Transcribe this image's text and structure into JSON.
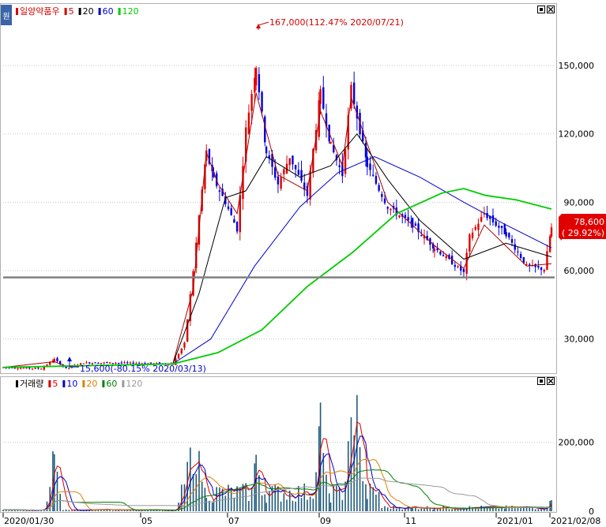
{
  "price_panel": {
    "legend": [
      {
        "text": "일양약품우",
        "color": "#d40000"
      },
      {
        "text": "5",
        "color": "#d40000"
      },
      {
        "text": "20",
        "color": "#000000"
      },
      {
        "text": "60",
        "color": "#0000cc"
      },
      {
        "text": "120",
        "color": "#00cc00"
      }
    ],
    "annotation_high": "167,000(112.47% 2020/07/21)",
    "annotation_low": "15,600(-80.15% 2020/03/13)",
    "last_price": "78,600",
    "last_change": "( 29.92%)",
    "side_tag": "원"
  },
  "volume_panel": {
    "legend": [
      {
        "text": "거래량",
        "color": "#000000"
      },
      {
        "text": "5",
        "color": "#d40000"
      },
      {
        "text": "10",
        "color": "#0000cc"
      },
      {
        "text": "20",
        "color": "#e08000"
      },
      {
        "text": "60",
        "color": "#008000"
      },
      {
        "text": "120",
        "color": "#999999"
      }
    ]
  },
  "x_axis_labels": [
    "2020/01/30",
    "05",
    "07",
    "09",
    "11",
    "2021/01",
    "2021/02/08"
  ],
  "colors": {
    "up": "#e00000",
    "down": "#0000dd",
    "ma5": "#aa0000",
    "ma20": "#000000",
    "ma60": "#0000cc",
    "ma120": "#00cc00",
    "hline": "#808080"
  },
  "chart_data": [
    {
      "type": "candlestick",
      "title": "일양약품우",
      "x_range": [
        "2020/01/30",
        "2021/02/08"
      ],
      "ylim": [
        16000,
        176000
      ],
      "y_ticks": [
        30000,
        60000,
        90000,
        120000,
        150000
      ],
      "y_tick_labels": [
        "30,000",
        "60,000",
        "90,000",
        "120,000",
        "150,000"
      ],
      "horizontal_line": 57000,
      "close_trend": [
        {
          "date": "2020-01-30",
          "close": 17500
        },
        {
          "date": "2020-02-25",
          "close": 17000
        },
        {
          "date": "2020-03-05",
          "close": 21000
        },
        {
          "date": "2020-03-13",
          "close": 17000
        },
        {
          "date": "2020-03-25",
          "close": 19500
        },
        {
          "date": "2020-04-20",
          "close": 19500
        },
        {
          "date": "2020-05-25",
          "close": 19000
        },
        {
          "date": "2020-06-02",
          "close": 28000
        },
        {
          "date": "2020-06-08",
          "close": 60000
        },
        {
          "date": "2020-06-12",
          "close": 84000
        },
        {
          "date": "2020-06-17",
          "close": 112000
        },
        {
          "date": "2020-06-22",
          "close": 100000
        },
        {
          "date": "2020-06-30",
          "close": 90000
        },
        {
          "date": "2020-07-08",
          "close": 78000
        },
        {
          "date": "2020-07-14",
          "close": 122000
        },
        {
          "date": "2020-07-21",
          "close": 150000
        },
        {
          "date": "2020-07-28",
          "close": 112000
        },
        {
          "date": "2020-08-05",
          "close": 98000
        },
        {
          "date": "2020-08-13",
          "close": 110000
        },
        {
          "date": "2020-08-25",
          "close": 93000
        },
        {
          "date": "2020-09-03",
          "close": 138000
        },
        {
          "date": "2020-09-10",
          "close": 115000
        },
        {
          "date": "2020-09-18",
          "close": 102000
        },
        {
          "date": "2020-09-24",
          "close": 140000
        },
        {
          "date": "2020-10-05",
          "close": 106000
        },
        {
          "date": "2020-10-19",
          "close": 88000
        },
        {
          "date": "2020-11-05",
          "close": 80000
        },
        {
          "date": "2020-11-20",
          "close": 70000
        },
        {
          "date": "2020-12-10",
          "close": 59000
        },
        {
          "date": "2020-12-14",
          "close": 75000
        },
        {
          "date": "2020-12-24",
          "close": 85000
        },
        {
          "date": "2021-01-08",
          "close": 76000
        },
        {
          "date": "2021-01-22",
          "close": 62000
        },
        {
          "date": "2021-02-03",
          "close": 60500
        },
        {
          "date": "2021-02-08",
          "close": 78600
        }
      ],
      "moving_averages": [
        {
          "name": "5",
          "points": [
            {
              "date": "2020-01-30",
              "value": 17500
            },
            {
              "date": "2020-03-05",
              "value": 20000
            },
            {
              "date": "2020-03-13",
              "value": 18000
            },
            {
              "date": "2020-05-25",
              "value": 19000
            },
            {
              "date": "2020-06-08",
              "value": 52000
            },
            {
              "date": "2020-06-17",
              "value": 112000
            },
            {
              "date": "2020-06-25",
              "value": 98000
            },
            {
              "date": "2020-07-08",
              "value": 85000
            },
            {
              "date": "2020-07-21",
              "value": 138000
            },
            {
              "date": "2020-08-05",
              "value": 102000
            },
            {
              "date": "2020-08-25",
              "value": 95000
            },
            {
              "date": "2020-09-03",
              "value": 130000
            },
            {
              "date": "2020-09-18",
              "value": 106000
            },
            {
              "date": "2020-09-24",
              "value": 136000
            },
            {
              "date": "2020-10-19",
              "value": 90000
            },
            {
              "date": "2020-11-20",
              "value": 71000
            },
            {
              "date": "2020-12-10",
              "value": 61000
            },
            {
              "date": "2020-12-24",
              "value": 80000
            },
            {
              "date": "2021-01-22",
              "value": 62000
            },
            {
              "date": "2021-02-08",
              "value": 63000
            }
          ]
        },
        {
          "name": "20",
          "points": [
            {
              "date": "2020-01-30",
              "value": 17500
            },
            {
              "date": "2020-05-25",
              "value": 19000
            },
            {
              "date": "2020-06-12",
              "value": 50000
            },
            {
              "date": "2020-06-30",
              "value": 92000
            },
            {
              "date": "2020-07-14",
              "value": 95000
            },
            {
              "date": "2020-07-28",
              "value": 110000
            },
            {
              "date": "2020-08-20",
              "value": 101000
            },
            {
              "date": "2020-09-10",
              "value": 106000
            },
            {
              "date": "2020-09-28",
              "value": 120000
            },
            {
              "date": "2020-10-19",
              "value": 100000
            },
            {
              "date": "2020-11-10",
              "value": 82000
            },
            {
              "date": "2020-12-10",
              "value": 65000
            },
            {
              "date": "2021-01-08",
              "value": 72000
            },
            {
              "date": "2021-02-08",
              "value": 66000
            }
          ]
        },
        {
          "name": "60",
          "points": [
            {
              "date": "2020-01-30",
              "value": 17500
            },
            {
              "date": "2020-05-25",
              "value": 19000
            },
            {
              "date": "2020-06-20",
              "value": 30000
            },
            {
              "date": "2020-07-20",
              "value": 62000
            },
            {
              "date": "2020-08-20",
              "value": 88000
            },
            {
              "date": "2020-09-15",
              "value": 103000
            },
            {
              "date": "2020-10-10",
              "value": 110000
            },
            {
              "date": "2020-11-10",
              "value": 101000
            },
            {
              "date": "2020-12-10",
              "value": 90000
            },
            {
              "date": "2021-01-08",
              "value": 80000
            },
            {
              "date": "2021-02-08",
              "value": 70000
            }
          ]
        },
        {
          "name": "120",
          "points": [
            {
              "date": "2020-01-30",
              "value": 17500
            },
            {
              "date": "2020-05-25",
              "value": 19000
            },
            {
              "date": "2020-06-25",
              "value": 24000
            },
            {
              "date": "2020-07-25",
              "value": 34000
            },
            {
              "date": "2020-08-25",
              "value": 53000
            },
            {
              "date": "2020-09-25",
              "value": 68000
            },
            {
              "date": "2020-10-25",
              "value": 85000
            },
            {
              "date": "2020-11-25",
              "value": 94000
            },
            {
              "date": "2020-12-10",
              "value": 96000
            },
            {
              "date": "2020-12-25",
              "value": 93000
            },
            {
              "date": "2021-01-15",
              "value": 91000
            },
            {
              "date": "2021-02-08",
              "value": 87000
            }
          ]
        }
      ]
    },
    {
      "type": "bar",
      "title": "거래량",
      "ylim": [
        0,
        380000
      ],
      "y_ticks": [
        0,
        200000
      ],
      "y_tick_labels": [
        "0",
        "200,000"
      ],
      "volume_peaks": [
        {
          "date": "2020-03-05",
          "value": 220000
        },
        {
          "date": "2020-06-05",
          "value": 230000
        },
        {
          "date": "2020-06-12",
          "value": 210000
        },
        {
          "date": "2020-07-21",
          "value": 200000
        },
        {
          "date": "2020-09-03",
          "value": 320000
        },
        {
          "date": "2020-09-24",
          "value": 320000
        },
        {
          "date": "2020-09-28",
          "value": 370000
        },
        {
          "date": "2021-02-08",
          "value": 40000
        }
      ]
    }
  ]
}
